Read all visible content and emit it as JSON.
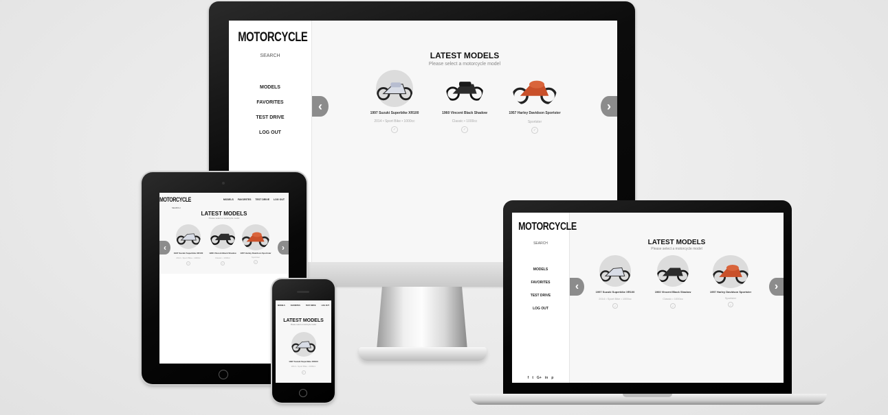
{
  "site": {
    "logo": "MOTORCYCLE",
    "search_label": "SEARCH",
    "nav": [
      "MODELS",
      "FAVORITES",
      "TEST DRIVE",
      "LOG OUT"
    ],
    "title": "LATEST MODELS",
    "subtitle": "Please select a motorcycle model",
    "prev_arrow": "‹",
    "next_arrow": "›",
    "like_icon": "thumbs-up-icon",
    "social": [
      "f",
      "t",
      "G+",
      "in",
      "p"
    ]
  },
  "models": [
    {
      "name": "1997 Suzuki Superbike XR100",
      "meta": "2014 • Sport Bike • 1000cc",
      "color": "#d8dce6"
    },
    {
      "name": "1960 Vincent Black Shadow",
      "meta": "Classic • 1000cc",
      "color": "#2c2c2c"
    },
    {
      "name": "1957 Harley Davidson Sportster",
      "meta": "Sportster",
      "color": "#c9502a"
    }
  ],
  "colors": {
    "accent_arrow": "#8c8c8c",
    "screen_bg": "#f7f7f7",
    "bezel": "#000000"
  }
}
